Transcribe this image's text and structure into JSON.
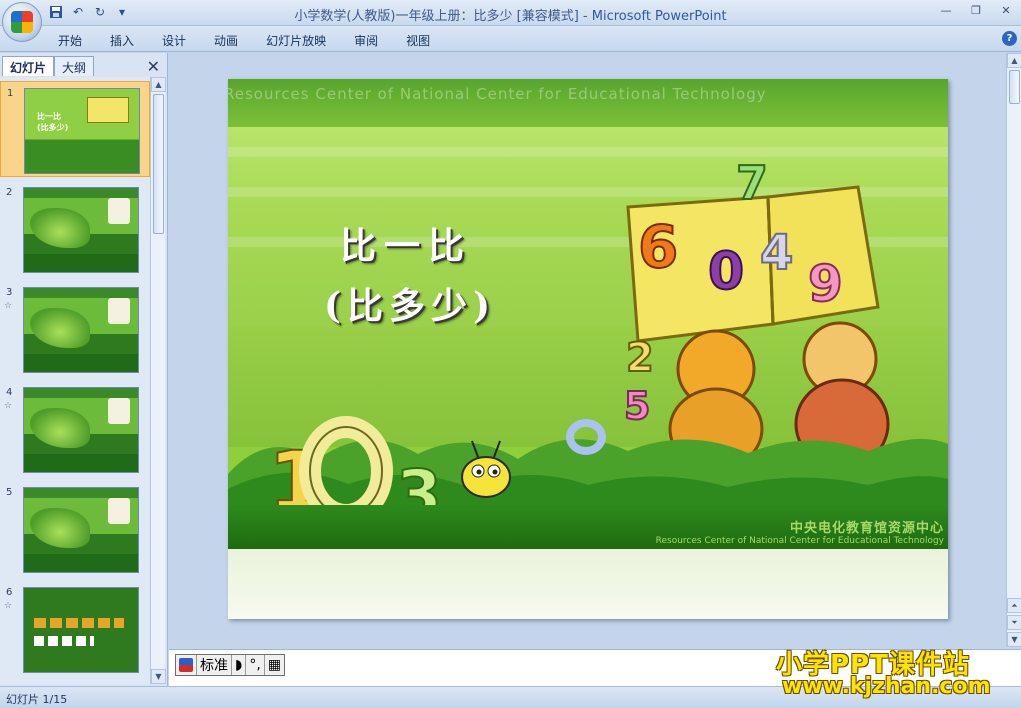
{
  "window": {
    "title_doc": "小学数学(人教版)一年级上册：比多少 [兼容模式] - ",
    "title_app": "Microsoft PowerPoint"
  },
  "quick_access": {
    "icons": [
      "save-icon",
      "undo-icon",
      "redo-icon",
      "customize-icon"
    ]
  },
  "ribbon": {
    "tabs": [
      "开始",
      "插入",
      "设计",
      "动画",
      "幻灯片放映",
      "审阅",
      "视图"
    ],
    "help": "?"
  },
  "left_panel": {
    "tabs": [
      "幻灯片",
      "大纲"
    ],
    "close": "✕",
    "thumbnails": [
      {
        "num": "1",
        "anim": ""
      },
      {
        "num": "2",
        "anim": ""
      },
      {
        "num": "3",
        "anim": "☆"
      },
      {
        "num": "4",
        "anim": "☆"
      },
      {
        "num": "5",
        "anim": ""
      },
      {
        "num": "6",
        "anim": "☆"
      }
    ]
  },
  "slide": {
    "watermark_top": "Resources Center of National  Center for Educational Technology",
    "title": "比一比",
    "subtitle": "(比多少)",
    "logo_cn": "中央电化教育馆资源中心",
    "logo_en": "Resources Center of National Center for Educational Technology",
    "numbers": [
      "6",
      "0",
      "4",
      "9",
      "7",
      "1",
      "0",
      "3",
      "2",
      "5"
    ]
  },
  "notes": {
    "ime_label": "标准"
  },
  "status": {
    "slide_counter": "幻灯片 1/15"
  },
  "site_watermark": {
    "line1": "小学PPT课件站",
    "line2": "www.kjzhan.com"
  },
  "colors": {
    "slide_green": "#8fcf3c",
    "dark_green": "#1d6b10",
    "accent_yellow": "#ffe400",
    "ribbon_blue": "#c7d8ee"
  }
}
